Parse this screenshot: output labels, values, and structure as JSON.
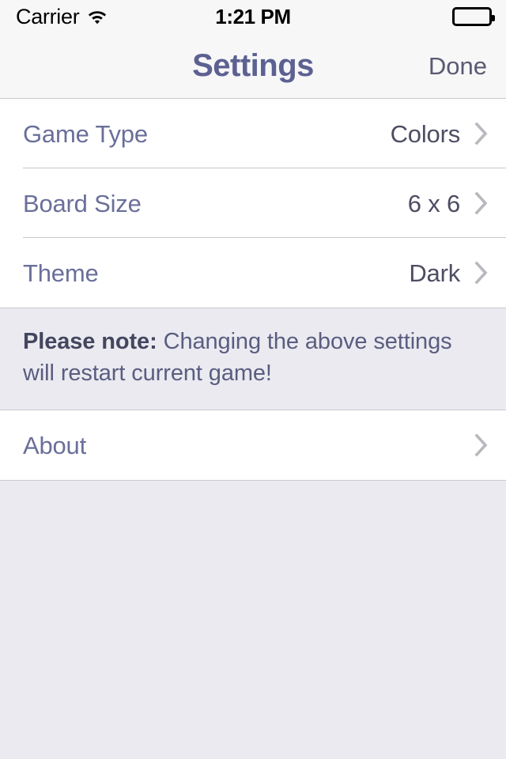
{
  "status_bar": {
    "carrier": "Carrier",
    "wifi_icon": "wifi-icon",
    "time": "1:21 PM",
    "battery_icon": "battery-full-icon"
  },
  "nav_bar": {
    "title": "Settings",
    "done_label": "Done",
    "title_color": "#5c6191",
    "done_color": "#5a5a72",
    "background": "#f7f7f8"
  },
  "settings_rows": [
    {
      "label": "Game Type",
      "value": "Colors",
      "accessory": "chevron-right-icon"
    },
    {
      "label": "Board Size",
      "value": "6 x 6",
      "accessory": "chevron-right-icon"
    },
    {
      "label": "Theme",
      "value": "Dark",
      "accessory": "chevron-right-icon"
    }
  ],
  "note": {
    "strong_text": "Please note:",
    "body_text": " Changing the above settings will restart current game!",
    "background": "#eaeaf0",
    "text_color": "#5a5d80"
  },
  "about_row": {
    "label": "About",
    "value": "",
    "accessory": "chevron-right-icon"
  },
  "colors": {
    "page_background": "#eaeaf0",
    "cell_background": "#ffffff",
    "separator": "#c8c8ce",
    "label": "#6a6f99",
    "value": "#4d4d63",
    "chevron": "#b8b8be"
  }
}
